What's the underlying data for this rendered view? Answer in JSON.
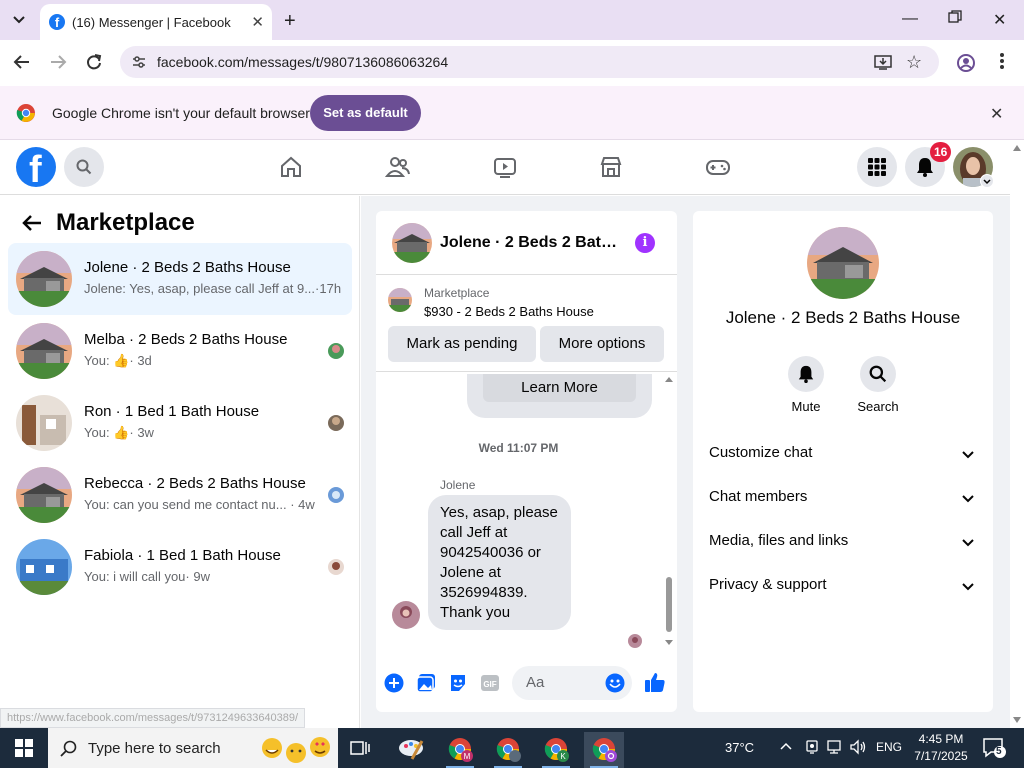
{
  "browser": {
    "tab_title": "(16) Messenger | Facebook",
    "url": "facebook.com/messages/t/9807136086063264",
    "infobar_message": "Google Chrome isn't your default browser",
    "infobar_button": "Set as default",
    "status_url": "https://www.facebook.com/messages/t/9731249633640389/"
  },
  "nav": {
    "notification_count": "16"
  },
  "left": {
    "title": "Marketplace",
    "conversations": [
      {
        "name": "Jolene · 2 Beds 2 Baths House",
        "preview": "Jolene: Yes, asap, please call Jeff at 9...",
        "time": "·17h",
        "active": true
      },
      {
        "name": "Melba · 2 Beds 2 Baths House",
        "preview": "You:",
        "time": "· 3d",
        "thumbs": true
      },
      {
        "name": "Ron · 1 Bed 1 Bath House",
        "preview": "You:",
        "time": "· 3w",
        "thumbs": true
      },
      {
        "name": "Rebecca · 2 Beds 2 Baths House",
        "preview": "You: can you send me contact nu...",
        "time": "· 4w"
      },
      {
        "name": "Fabiola · 1 Bed 1 Bath House",
        "preview": "You: i will call you",
        "time": "· 9w"
      }
    ]
  },
  "chat": {
    "title": "Jolene · 2 Beds 2 Baths House",
    "marketplace_label": "Marketplace",
    "listing": "$930 - 2 Beds 2 Baths House",
    "mark_pending": "Mark as pending",
    "more_options": "More options",
    "learn_more": "Learn More",
    "timestamp": "Wed 11:07 PM",
    "sender": "Jolene",
    "message": "Yes, asap, please call Jeff at 9042540036 or Jolene at 3526994839. Thank you",
    "input_placeholder": "Aa"
  },
  "right": {
    "name": "Jolene · 2 Beds 2 Baths House",
    "mute": "Mute",
    "search": "Search",
    "sections": [
      "Customize chat",
      "Chat members",
      "Media, files and links",
      "Privacy & support"
    ]
  },
  "taskbar": {
    "search_placeholder": "Type here to search",
    "temperature": "37°C",
    "language": "ENG",
    "time": "4:45 PM",
    "date": "7/17/2025",
    "notification_count": "5"
  },
  "colors": {
    "fb_blue": "#1877f2",
    "messenger_blue": "#0866ff",
    "notification_red": "#e41e3f",
    "chrome_purple": "#6b4e94"
  }
}
